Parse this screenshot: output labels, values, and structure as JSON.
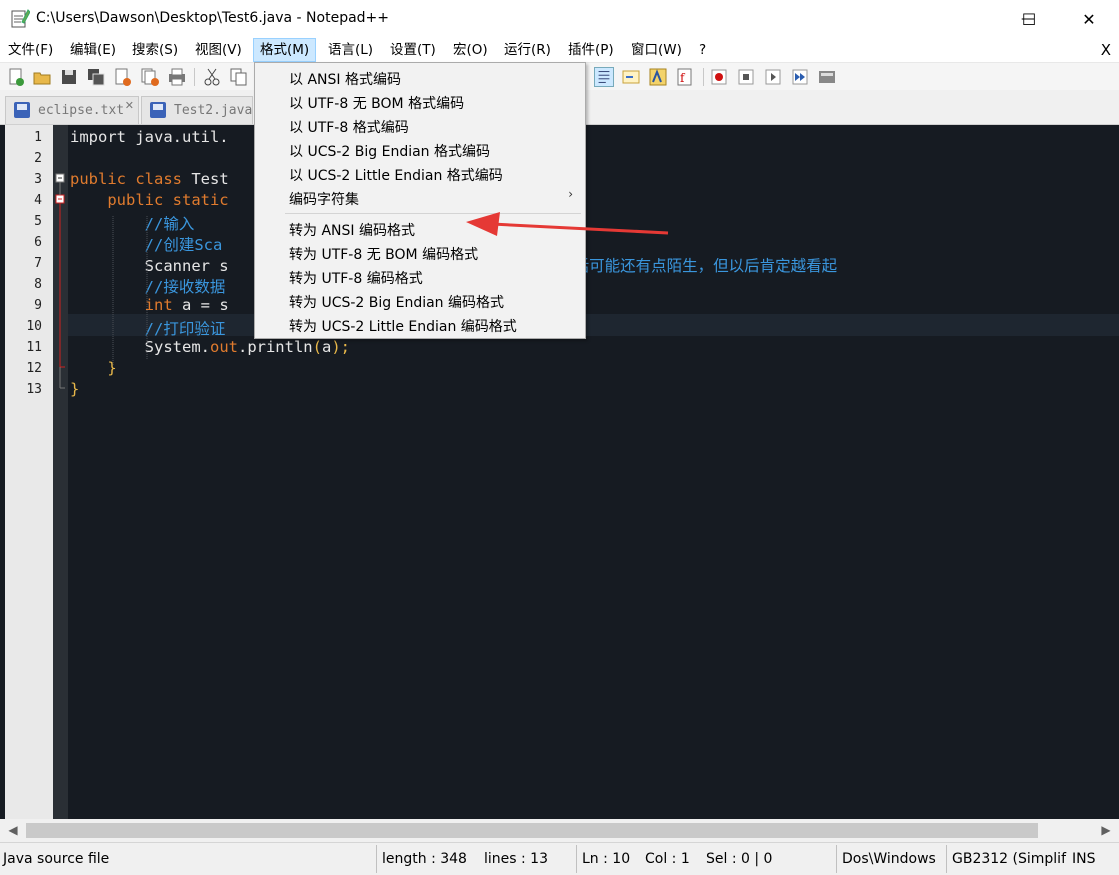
{
  "window": {
    "title": "C:\\Users\\Dawson\\Desktop\\Test6.java - Notepad++",
    "minimize": "—",
    "maximize": "☐",
    "close": "✕"
  },
  "menubar": {
    "items": [
      "文件(F)",
      "编辑(E)",
      "搜索(S)",
      "视图(V)",
      "格式(M)",
      "语言(L)",
      "设置(T)",
      "宏(O)",
      "运行(R)",
      "插件(P)",
      "窗口(W)",
      "?"
    ],
    "close_doc": "X"
  },
  "tabs": [
    {
      "label": "eclipse.txt",
      "close": "✕"
    },
    {
      "label": "Test2.java"
    }
  ],
  "editor": {
    "line_numbers": [
      "1",
      "2",
      "3",
      "4",
      "5",
      "6",
      "7",
      "8",
      "9",
      "10",
      "11",
      "12",
      "13"
    ],
    "lines": [
      {
        "segs": [
          {
            "t": "import java.util.",
            "c": "pl"
          }
        ]
      },
      {
        "segs": []
      },
      {
        "segs": [
          {
            "t": "public class ",
            "c": "kw"
          },
          {
            "t": "Test",
            "c": "pl"
          }
        ]
      },
      {
        "segs": [
          {
            "t": "    public static",
            "c": "kw"
          }
        ]
      },
      {
        "segs": [
          {
            "t": "        //输入",
            "c": "cm"
          }
        ]
      },
      {
        "segs": [
          {
            "t": "        //创建Sca",
            "c": "cm"
          }
        ]
      },
      {
        "segs": [
          {
            "t": "        Scanner s",
            "c": "pl"
          },
          {
            "t": "                         //现在看着这句话可能还有点陌生，但以后肯定越看起",
            "c": "cm"
          }
        ]
      },
      {
        "segs": [
          {
            "t": "        //接收数据",
            "c": "cm"
          }
        ]
      },
      {
        "segs": [
          {
            "t": "        int",
            "c": "kw"
          },
          {
            "t": " a = s",
            "c": "pl"
          }
        ]
      },
      {
        "segs": [
          {
            "t": "        //打印验证",
            "c": "cm"
          }
        ]
      },
      {
        "segs": [
          {
            "t": "        System.",
            "c": "pl"
          },
          {
            "t": "out",
            "c": "kw"
          },
          {
            "t": ".println",
            "c": "pl"
          },
          {
            "t": "(",
            "c": "op"
          },
          {
            "t": "a",
            "c": "pl"
          },
          {
            "t": ");",
            "c": "op"
          }
        ]
      },
      {
        "segs": [
          {
            "t": "    }",
            "c": "op"
          }
        ]
      },
      {
        "segs": [
          {
            "t": "}",
            "c": "op"
          }
        ]
      }
    ]
  },
  "format_menu": {
    "encode_items": [
      "以 ANSI 格式编码",
      "以 UTF-8 无 BOM 格式编码",
      "以 UTF-8 格式编码",
      "以 UCS-2 Big Endian 格式编码",
      "以 UCS-2 Little Endian 格式编码"
    ],
    "charset_item": "编码字符集",
    "submenu_arrow": "›",
    "convert_items": [
      "转为 ANSI 编码格式",
      "转为 UTF-8 无 BOM 编码格式",
      "转为 UTF-8 编码格式",
      "转为 UCS-2 Big Endian 编码格式",
      "转为 UCS-2 Little Endian 编码格式"
    ]
  },
  "statusbar": {
    "file_type": "Java source file",
    "length": "length : 348",
    "lines": "lines : 13",
    "ln": "Ln : 10",
    "col": "Col : 1",
    "sel": "Sel : 0 | 0",
    "eol": "Dos\\Windows",
    "encoding": "GB2312 (Simplif",
    "mode": "INS"
  },
  "colors": {
    "annotation_arrow": "#e53935",
    "menu_highlight": "#cce8ff",
    "editor_bg": "#161b22"
  },
  "icons": [
    "notepad-icon",
    "new-file-icon",
    "open-folder-icon",
    "save-icon",
    "save-all-icon",
    "close-icon",
    "close-all-icon",
    "print-icon",
    "cut-icon",
    "copy-icon",
    "word-wrap-icon",
    "indent-guide-icon",
    "doc-map-icon",
    "function-list-icon",
    "record-macro-icon",
    "stop-macro-icon",
    "play-macro-icon",
    "run-macro-multiple-icon",
    "save-macro-icon",
    "java-file-icon"
  ]
}
